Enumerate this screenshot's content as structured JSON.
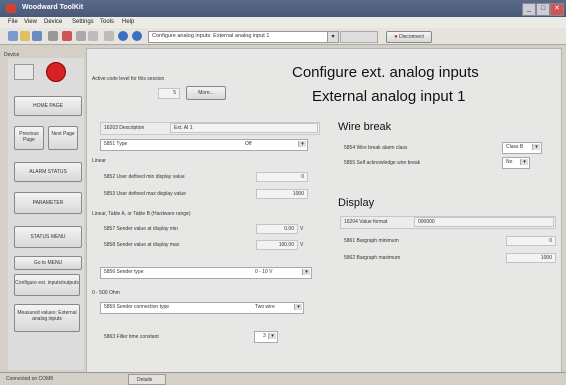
{
  "window": {
    "title": "Woodward ToolKit",
    "minimize": "_",
    "maximize": "□",
    "close": "✕"
  },
  "menu": [
    "File",
    "View",
    "Device",
    "Settings",
    "Tools",
    "Help"
  ],
  "toolbar": {
    "path": "Configure analog inputs: External analog input 1",
    "disconnect": "Disconnect"
  },
  "sidebar": {
    "device_label": "Device",
    "home": "HOME PAGE",
    "previous": "Previous Page",
    "next": "Next Page",
    "alarm": "ALARM STATUS",
    "parameter": "PARAMETER",
    "status_menu": "STATUS MENU",
    "go_menu": "Go to MENU",
    "configure": "Configure ext. inputs/outputs",
    "measured": "Measured values: External analog inputs"
  },
  "header": {
    "access_label": "Active code level for this session",
    "access_value": "5",
    "more_button": "More...",
    "title1": "Configure ext. analog inputs",
    "title2": "External analog input 1"
  },
  "left": {
    "description_label": "16203 Description",
    "description_value": "Ext. AI 1",
    "type_label": "5851 Type",
    "type_value": "Off",
    "linear_header": "Linear",
    "min_label": "5852 User defined min display value",
    "min_value": "0",
    "max_label": "5853 User defined max display value",
    "max_value": "1000",
    "table_header": "Linear, Table A, or Table B (Hardware range)",
    "sender_min_label": "5857 Sender value at display min",
    "sender_min_value": "0.00",
    "sender_min_unit": "V",
    "sender_max_label": "5858 Sender value at display max",
    "sender_max_value": "100.00",
    "sender_max_unit": "V",
    "sender_type_label": "5856 Sender type",
    "sender_type_value": "0 - 10 V",
    "r500_header": "0 - 500 Ohm",
    "connection_label": "5859 Sender connection type",
    "connection_value": "Two wire",
    "filter_label": "5863 Filter time constant",
    "filter_value": "3"
  },
  "right": {
    "wire_break_title": "Wire break",
    "alarm_class_label": "5854 Wire break alarm class",
    "alarm_class_value": "Class B",
    "self_ack_label": "5855 Self acknowledge wire break",
    "self_ack_value": "No",
    "display_title": "Display",
    "value_format_label": "16204 Value format",
    "value_format_value": "000000",
    "bar_min_label": "5861 Bargraph minimum",
    "bar_min_value": "0",
    "bar_max_label": "5862 Bargraph maximum",
    "bar_max_value": "1000"
  },
  "statusbar": {
    "left": "Connected on COM8",
    "tab": "Details"
  }
}
